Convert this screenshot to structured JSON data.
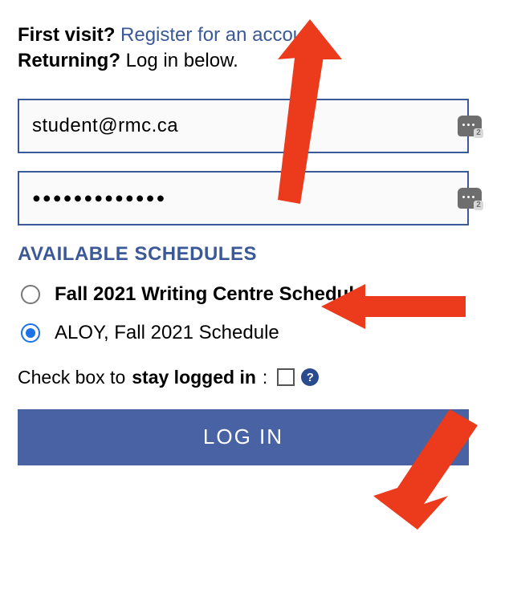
{
  "intro": {
    "first_visit_label": "First visit?",
    "register_link": "Register for an account",
    "period": ".",
    "returning_label": "Returning?",
    "returning_text": "Log in below."
  },
  "email": {
    "value": "student@rmc.ca",
    "autofill_badge": "2"
  },
  "password": {
    "mask": "●●●●●●●●●●●●●",
    "autofill_badge": "2"
  },
  "schedules": {
    "title": "AVAILABLE SCHEDULES",
    "options": [
      {
        "label": "Fall 2021 Writing Centre Schedule",
        "checked": false,
        "bold": true
      },
      {
        "label": "ALOY, Fall 2021 Schedule",
        "checked": true,
        "bold": false
      }
    ]
  },
  "stay": {
    "prefix": "Check box to ",
    "bold": "stay logged in",
    "suffix": ":",
    "help": "?"
  },
  "login_button": "LOG IN"
}
